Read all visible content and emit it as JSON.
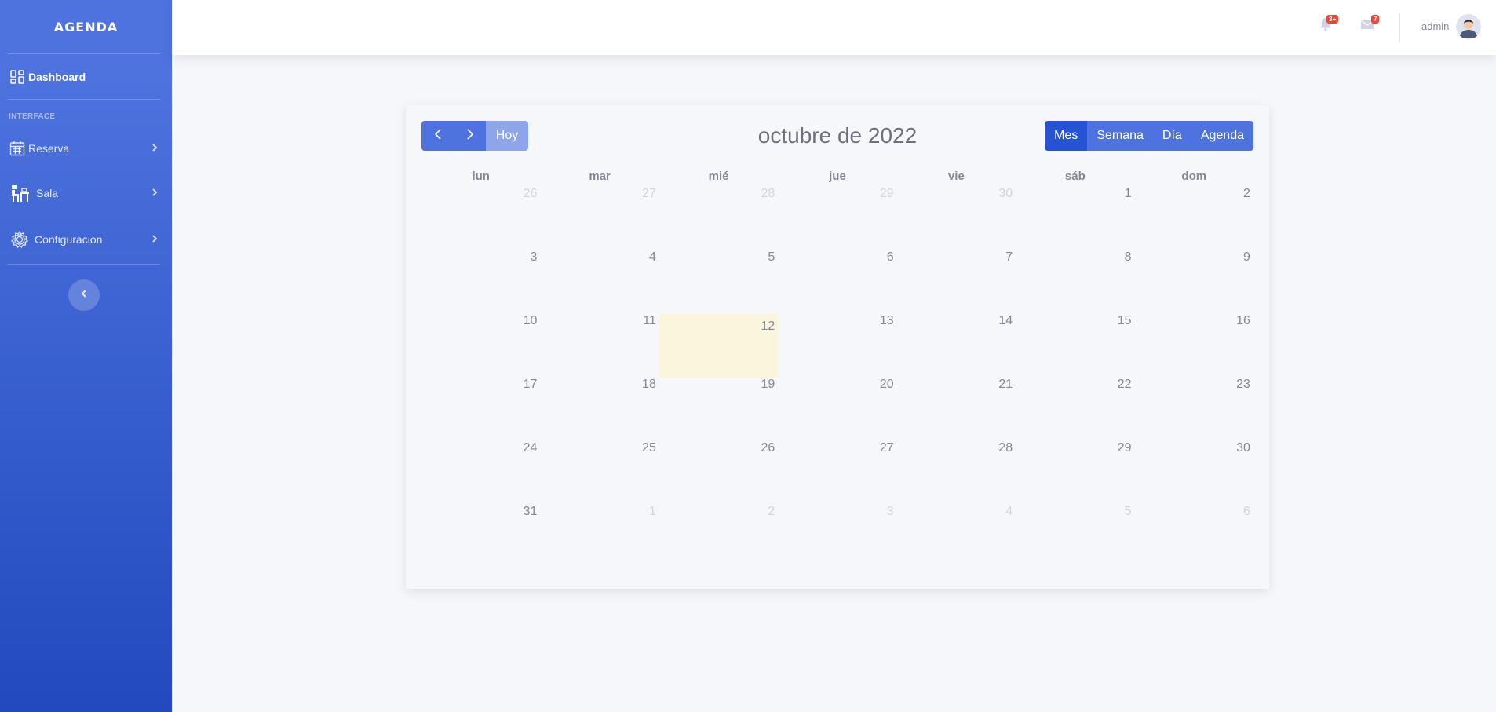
{
  "sidebar": {
    "brand": "AGENDA",
    "dashboard": "Dashboard",
    "heading": "INTERFACE",
    "items": [
      {
        "label": "Reserva",
        "icon": "calendar-icon"
      },
      {
        "label": "Sala",
        "icon": "room-icon"
      },
      {
        "label": "Configuracion",
        "icon": "gear-icon"
      }
    ]
  },
  "topbar": {
    "alerts_badge": "3+",
    "messages_badge": "7",
    "user": "admin"
  },
  "calendar": {
    "title": "octubre de 2022",
    "today_label": "Hoy",
    "views": [
      "Mes",
      "Semana",
      "Día",
      "Agenda"
    ],
    "active_view": "Mes",
    "weekdays": [
      "lun",
      "mar",
      "mié",
      "jue",
      "vie",
      "sáb",
      "dom"
    ],
    "weeks": [
      [
        "26",
        "27",
        "28",
        "29",
        "30",
        "1",
        "2"
      ],
      [
        "3",
        "4",
        "5",
        "6",
        "7",
        "8",
        "9"
      ],
      [
        "10",
        "11",
        "12",
        "13",
        "14",
        "15",
        "16"
      ],
      [
        "17",
        "18",
        "19",
        "20",
        "21",
        "22",
        "23"
      ],
      [
        "24",
        "25",
        "26",
        "27",
        "28",
        "29",
        "30"
      ],
      [
        "31",
        "1",
        "2",
        "3",
        "4",
        "5",
        "6"
      ]
    ]
  },
  "colors": {
    "primary": "#4e73df",
    "active_view": "#2653d4",
    "today_highlight": "#faf5dc",
    "badge": "#e74a3b"
  }
}
